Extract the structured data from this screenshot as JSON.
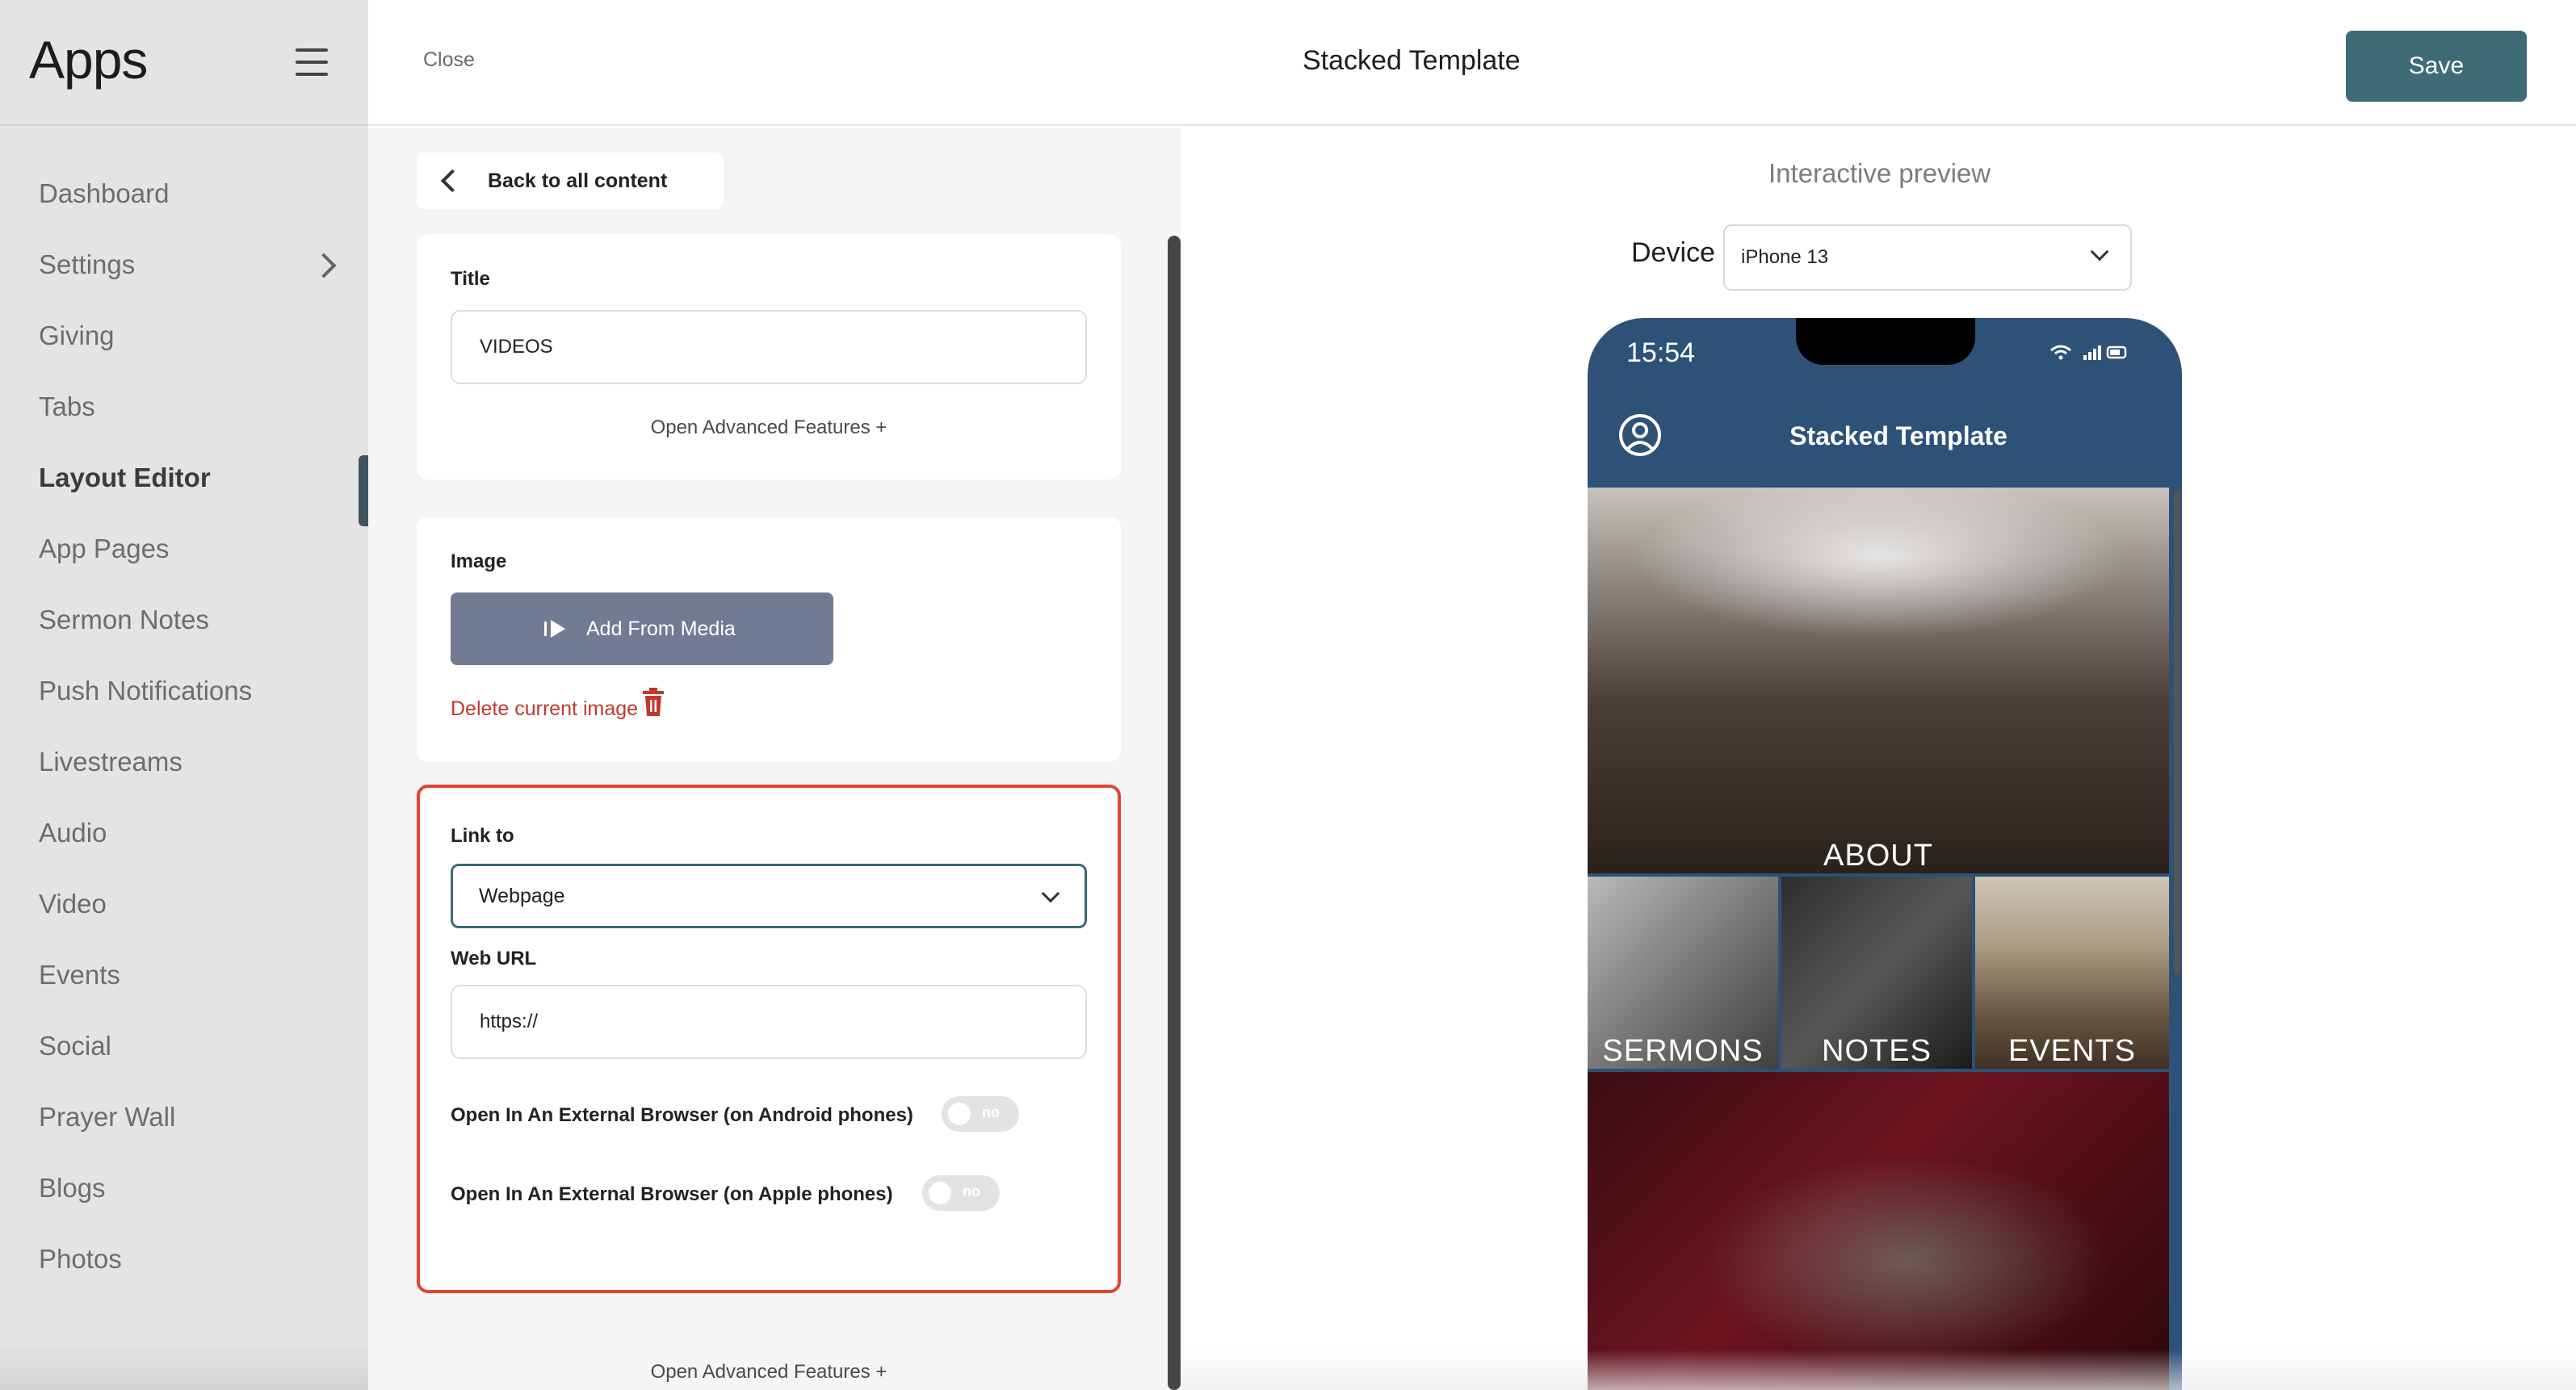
{
  "sidebar": {
    "app_title": "Apps",
    "items": [
      {
        "label": "Dashboard"
      },
      {
        "label": "Settings"
      },
      {
        "label": "Giving"
      },
      {
        "label": "Tabs"
      },
      {
        "label": "Layout Editor"
      },
      {
        "label": "App Pages"
      },
      {
        "label": "Sermon Notes"
      },
      {
        "label": "Push Notifications"
      },
      {
        "label": "Livestreams"
      },
      {
        "label": "Audio"
      },
      {
        "label": "Video"
      },
      {
        "label": "Events"
      },
      {
        "label": "Social"
      },
      {
        "label": "Prayer Wall"
      },
      {
        "label": "Blogs"
      },
      {
        "label": "Photos"
      }
    ],
    "active_item": "Layout Editor"
  },
  "topbar": {
    "close_label": "Close",
    "title": "Stacked Template",
    "save_label": "Save"
  },
  "editor": {
    "back_label": "Back to all content",
    "title_card": {
      "label": "Title",
      "value": "VIDEOS",
      "advanced_label": "Open Advanced Features +"
    },
    "image_card": {
      "label": "Image",
      "add_media_label": "Add From Media",
      "delete_label": "Delete current image"
    },
    "link_card": {
      "link_label": "Link to",
      "link_value": "Webpage",
      "url_label": "Web URL",
      "url_value": "https://",
      "android_label": "Open In An External Browser (on Android phones)",
      "android_toggle": "no",
      "apple_label": "Open In An External Browser (on Apple phones)",
      "apple_toggle": "no"
    },
    "bottom_advanced_label": "Open Advanced Features +"
  },
  "preview": {
    "title": "Interactive preview",
    "device_label": "Device",
    "device_value": "iPhone 13",
    "phone": {
      "time": "15:54",
      "title": "Stacked Template",
      "tiles": {
        "about": "ABOUT",
        "sermons": "SERMONS",
        "notes": "NOTES",
        "events": "EVENTS"
      }
    }
  },
  "colors": {
    "accent": "#3f6b77",
    "phone_header": "#2e5177",
    "highlight_border": "#e3452f",
    "delete": "#c0392b",
    "media_button": "#717b94"
  }
}
